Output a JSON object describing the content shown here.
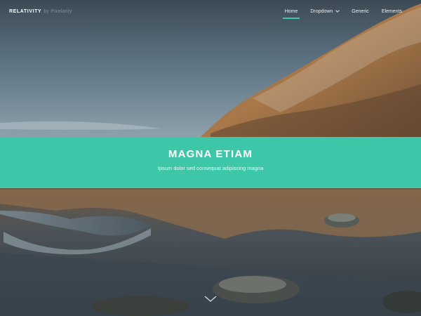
{
  "header": {
    "logo": "RELATIVITY",
    "logo_byline": "by Pixelarity"
  },
  "nav": {
    "items": [
      {
        "label": "Home",
        "active": true
      },
      {
        "label": "Dropdown",
        "has_dropdown": true
      },
      {
        "label": "Generic"
      },
      {
        "label": "Elements"
      }
    ]
  },
  "banner": {
    "title": "MAGNA ETIAM",
    "subtitle": "Ipsum dolor sed consequat adipiscing magna"
  },
  "icons": {
    "scroll_down": "chevron-down-icon",
    "dropdown_caret": "caret-down-icon"
  },
  "colors": {
    "accent": "#3ec6a8",
    "text": "#ffffff"
  }
}
